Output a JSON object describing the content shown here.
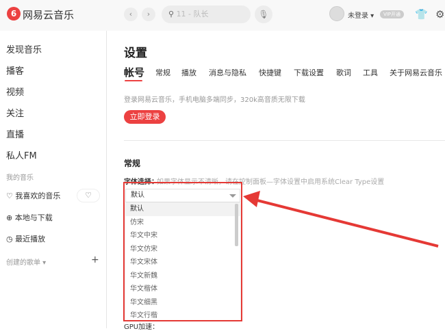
{
  "app": {
    "name": "网易云音乐",
    "logo_glyph": "6"
  },
  "header": {
    "search_placeholder": "11 - 队长",
    "user": "未登录 ▾",
    "vip": "VIP开通",
    "back": "‹",
    "forward": "›",
    "mic": "🎙",
    "search_icon": "⚲",
    "skin_icon": "👕",
    "settings_icon": "⚙"
  },
  "sidebar": {
    "items": [
      "发现音乐",
      "播客",
      "视频",
      "关注",
      "直播",
      "私人FM"
    ],
    "my_music_header": "我的音乐",
    "my_music": [
      {
        "icon": "♡",
        "label": "我喜欢的音乐"
      },
      {
        "icon": "⊕",
        "label": "本地与下载"
      },
      {
        "icon": "◷",
        "label": "最近播放"
      }
    ],
    "heartbeat_icon": "♡",
    "playlists_header": "创建的歌单 ▾",
    "add": "+"
  },
  "main": {
    "title": "设置",
    "tabs": [
      "帐号",
      "常规",
      "播放",
      "消息与隐私",
      "快捷键",
      "下载设置",
      "歌词",
      "工具",
      "关于网易云音乐"
    ],
    "active_tab": "帐号",
    "login_desc": "登录网易云音乐，手机电脑多端同步，320k高音质无限下载",
    "login_button": "立即登录",
    "section": "常规",
    "font_label": "字体选择：",
    "font_hint": "如果字体显示不清晰，请在控制面板—字体设置中启用系统Clear Type设置",
    "font_selected": "默认",
    "font_options": [
      "默认",
      "仿宋",
      "华文中宋",
      "华文仿宋",
      "华文宋体",
      "华文新魏",
      "华文楷体",
      "华文细黑",
      "华文行楷"
    ],
    "gpu_label": "GPU加速："
  },
  "colors": {
    "accent": "#ec4141",
    "annotation": "#e53935"
  }
}
